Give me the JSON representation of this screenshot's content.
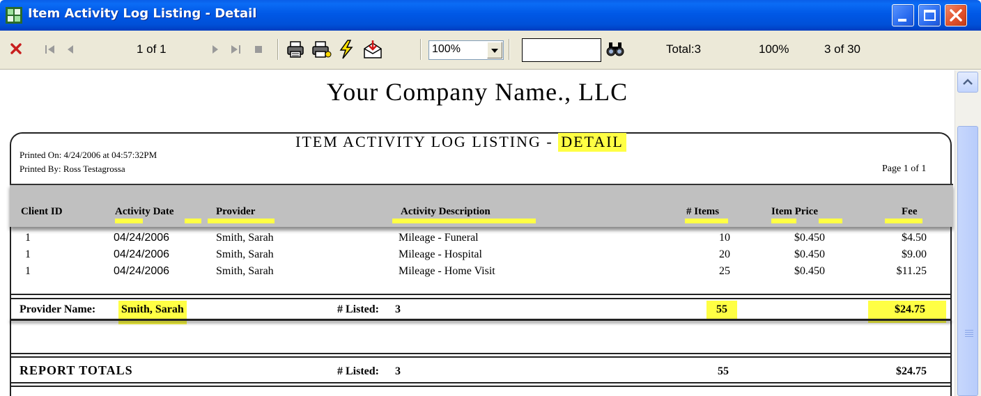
{
  "window": {
    "title": "Item Activity Log Listing - Detail"
  },
  "toolbar": {
    "page_indicator": "1 of 1",
    "zoom_value": "100%",
    "search_value": "",
    "total_label": "Total:3",
    "percent_label": "100%",
    "record_count": "3 of 30",
    "icons": [
      "close-icon",
      "first-page-icon",
      "previous-page-icon",
      "next-page-icon",
      "last-page-icon",
      "stop-icon",
      "print-icon",
      "print-setup-icon",
      "refresh-icon",
      "export-icon",
      "find-icon"
    ]
  },
  "report": {
    "company_name": "Your Company Name., LLC",
    "title_main": "ITEM ACTIVITY LOG LISTING - ",
    "title_highlight": "DETAIL",
    "printed_on": "Printed On: 4/24/2006 at 04:57:32PM",
    "printed_by": "Printed By: Ross Testagrossa",
    "page_label": "Page 1 of 1",
    "columns": [
      "Client ID",
      "Activity Date",
      "Provider",
      "Activity Description",
      "# Items",
      "Item Price",
      "Fee"
    ],
    "rows": [
      {
        "client_id": "1",
        "activity_date": "04/24/2006",
        "provider": "Smith, Sarah",
        "description": "Mileage - Funeral",
        "items": "10",
        "item_price": "$0.450",
        "fee": "$4.50"
      },
      {
        "client_id": "1",
        "activity_date": "04/24/2006",
        "provider": "Smith, Sarah",
        "description": "Mileage - Hospital",
        "items": "20",
        "item_price": "$0.450",
        "fee": "$9.00"
      },
      {
        "client_id": "1",
        "activity_date": "04/24/2006",
        "provider": "Smith, Sarah",
        "description": "Mileage - Home Visit",
        "items": "25",
        "item_price": "$0.450",
        "fee": "$11.25"
      }
    ],
    "provider_summary": {
      "label": "Provider Name:",
      "name": "Smith, Sarah",
      "listed_label": "# Listed:",
      "listed_count": "3",
      "items_total": "55",
      "fee_total": "$24.75"
    },
    "report_totals": {
      "label": "REPORT TOTALS",
      "listed_label": "# Listed:",
      "listed_count": "3",
      "items_total": "55",
      "fee_total": "$24.75"
    }
  },
  "colors": {
    "titlebar": "#0054e3",
    "toolbar_bg": "#ece9d8",
    "highlight": "#ffff44",
    "header_band": "#c0c0c0",
    "close_red": "#e2522c"
  }
}
